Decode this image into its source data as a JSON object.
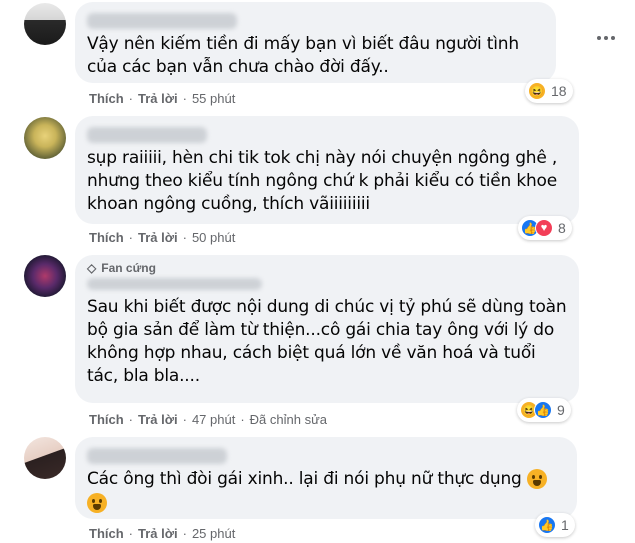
{
  "comments": [
    {
      "text": "Vậy nên kiếm tiền đi mấy bạn vì biết đâu người tình của các bạn vẫn chưa chào đời đấy..",
      "actions": {
        "like": "Thích",
        "reply": "Trả lời",
        "time": "55 phút"
      },
      "reaction_count": "18",
      "reactions": [
        "haha"
      ]
    },
    {
      "text": "sụp raiiiii, hèn chi tik tok chị này nói chuyện ngông ghê , nhưng theo kiểu tính ngông chứ k phải kiểu có tiền khoe khoan ngông cuồng, thích vãiiiiiiiii",
      "actions": {
        "like": "Thích",
        "reply": "Trả lời",
        "time": "50 phút"
      },
      "reaction_count": "8",
      "reactions": [
        "like",
        "love"
      ]
    },
    {
      "badge": "Fan cứng",
      "text": "Sau khi biết được nội dung di chúc vị tỷ phú sẽ dùng toàn bộ gia sản để làm từ thiện...cô gái chia tay ông với lý do không hợp nhau, cách biệt quá lớn về văn hoá và tuổi tác, bla bla....",
      "actions": {
        "like": "Thích",
        "reply": "Trả lời",
        "time": "47 phút",
        "edited": "Đã chỉnh sửa"
      },
      "reaction_count": "9",
      "reactions": [
        "haha",
        "like"
      ]
    },
    {
      "text": "Các ông thì đòi gái xinh.. lại đi nói phụ nữ thực dụng",
      "actions": {
        "like": "Thích",
        "reply": "Trả lời",
        "time": "25 phút"
      },
      "reaction_count": "1",
      "reactions": [
        "like"
      ]
    }
  ],
  "colors": {
    "bubble": "#f0f2f5",
    "meta": "#65676b",
    "like": "#1877f2",
    "love": "#f33e58",
    "haha": "#f7b125"
  }
}
